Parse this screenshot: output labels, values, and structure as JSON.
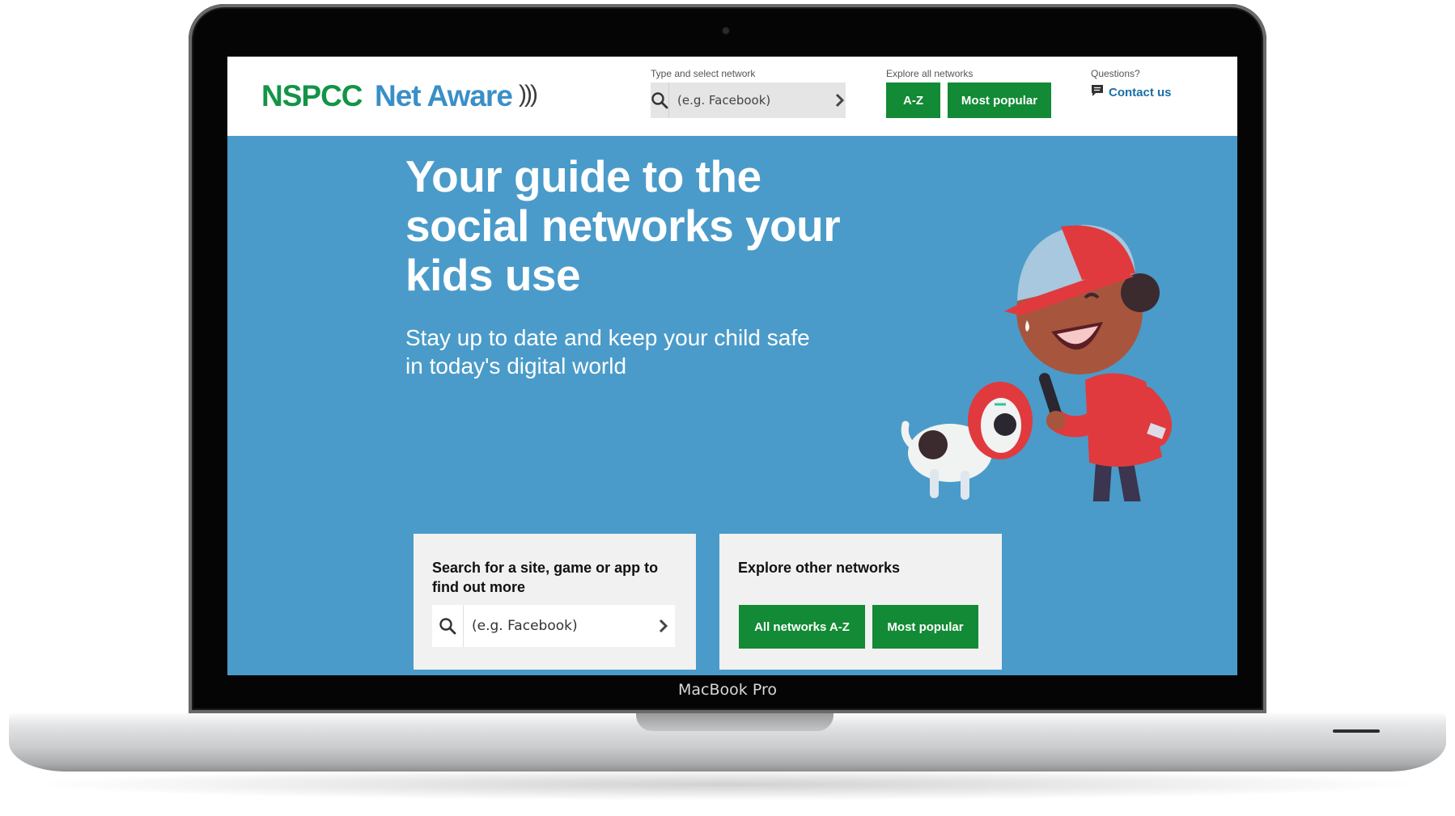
{
  "device": {
    "label": "MacBook Pro"
  },
  "header": {
    "brand": "NSPCC",
    "product": "Net Aware",
    "search": {
      "label": "Type and select network",
      "placeholder": "(e.g. Facebook)"
    },
    "explore": {
      "label": "Explore all networks",
      "az_button": "A-Z",
      "popular_button": "Most popular"
    },
    "questions": {
      "label": "Questions?",
      "contact_link": "Contact us"
    }
  },
  "hero": {
    "title": "Your guide to the social networks your kids use",
    "subtitle": "Stay up to date and keep your child safe in today's digital world"
  },
  "cards": {
    "search": {
      "title": "Search for a site, game or app to find out more",
      "placeholder": "(e.g. Facebook)"
    },
    "explore": {
      "title": "Explore other networks",
      "az_button": "All networks A-Z",
      "popular_button": "Most popular"
    }
  },
  "colors": {
    "brand_green": "#139447",
    "button_green": "#138a35",
    "hero_blue": "#4a9bc9",
    "net_aware_blue": "#3a8fc7"
  },
  "icons": [
    "search-icon",
    "chevron-right-icon",
    "chat-bubble-icon",
    "sound-waves-icon"
  ]
}
